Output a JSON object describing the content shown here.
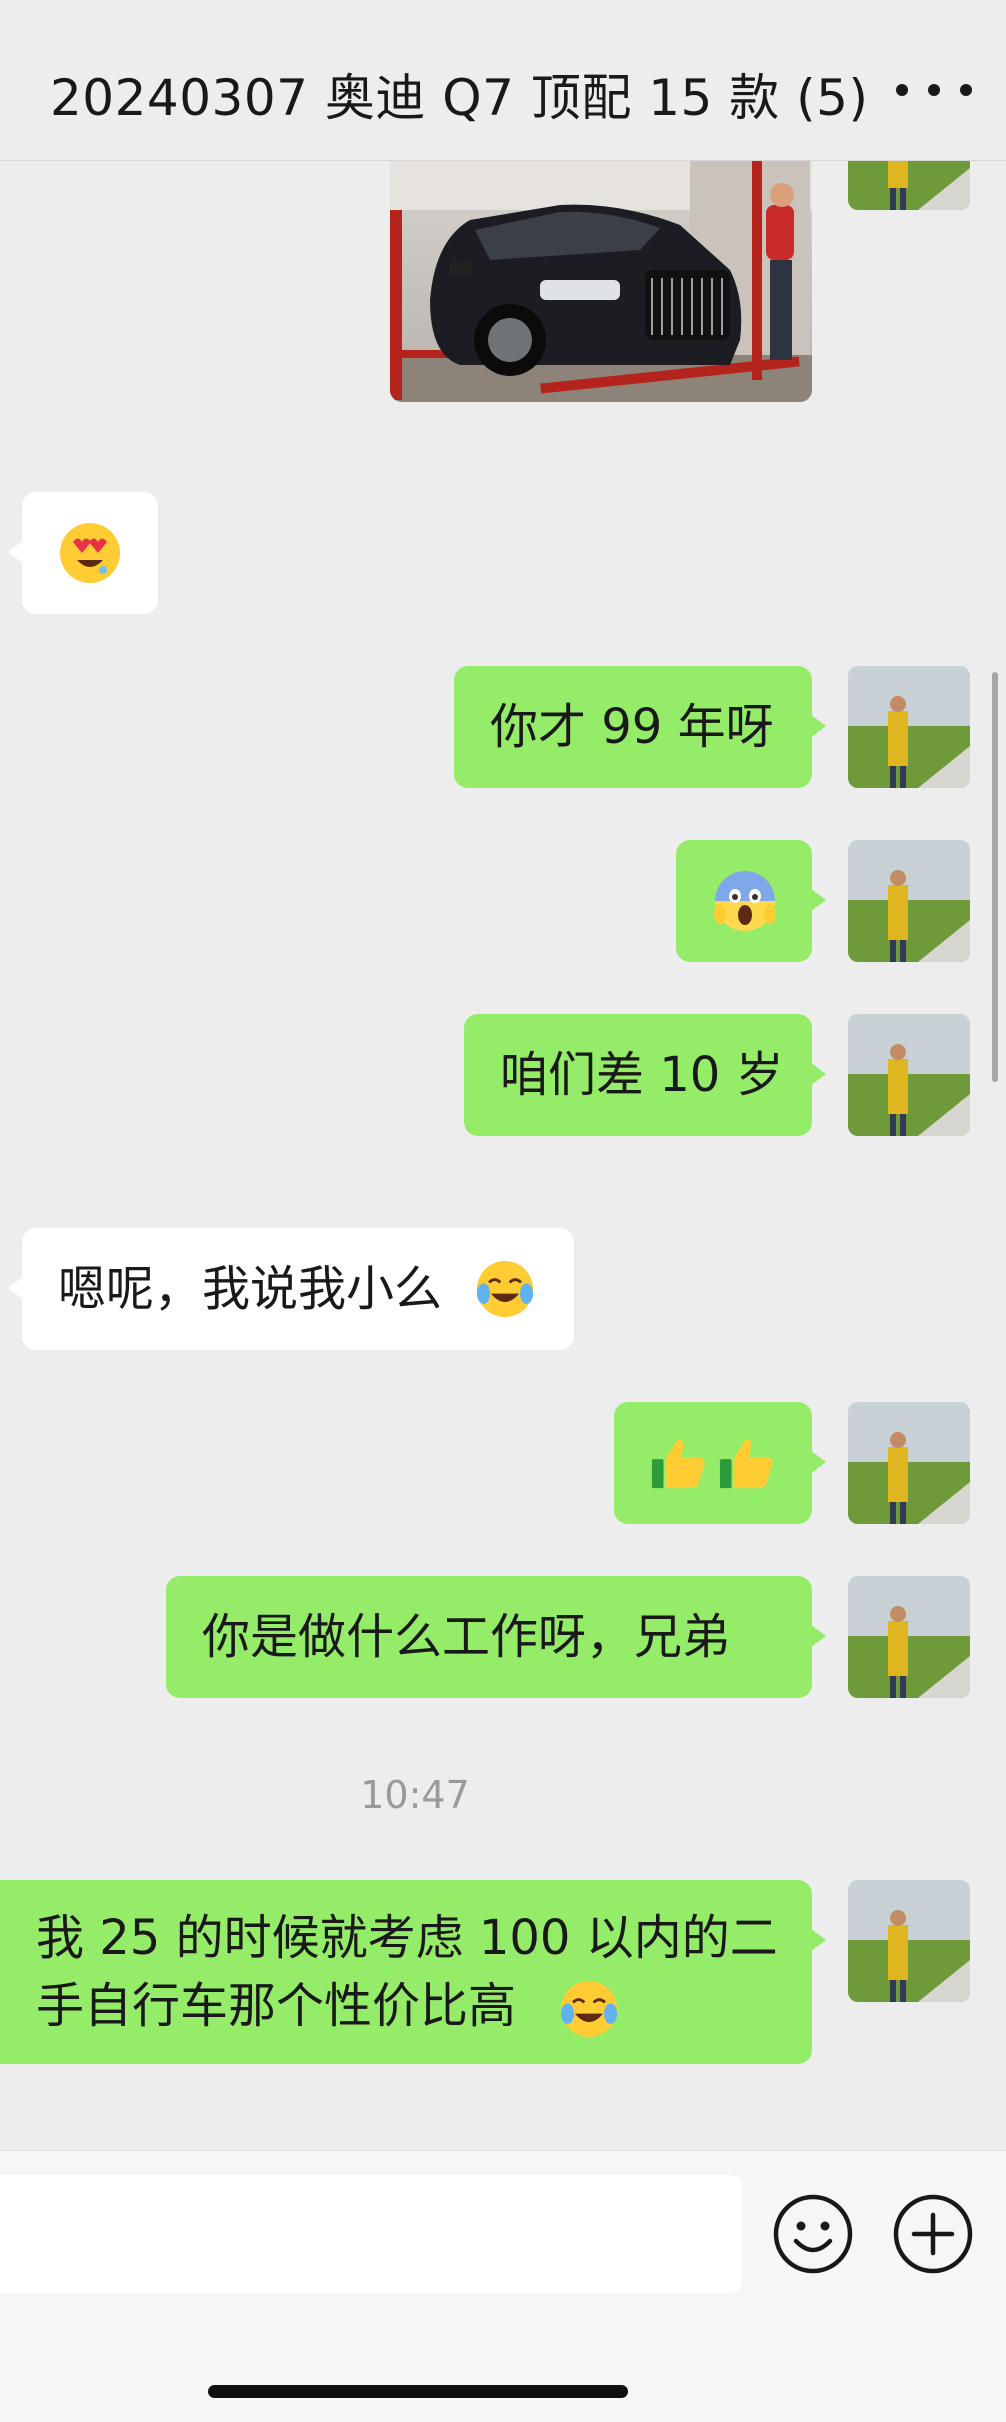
{
  "header": {
    "title": "20240307 奥迪 Q7 顶配 15 款 (5)",
    "more_icon": "more-dots-icon"
  },
  "messages": [
    {
      "side": "right",
      "type": "image",
      "content": "photo of black Audi Q7 SUV on a lift in a garage"
    },
    {
      "side": "left",
      "type": "emoji",
      "content": "😍"
    },
    {
      "side": "right",
      "type": "text",
      "content": "你才 99 年呀"
    },
    {
      "side": "right",
      "type": "emoji",
      "content": "😱"
    },
    {
      "side": "right",
      "type": "text",
      "content": "咱们差 10 岁"
    },
    {
      "side": "left",
      "type": "text",
      "content": "嗯呢，我说我小么"
    },
    {
      "side": "right",
      "type": "emoji",
      "content": "👍👍"
    },
    {
      "side": "right",
      "type": "text",
      "content": "你是做什么工作呀，兄弟"
    },
    {
      "side": "right",
      "type": "text",
      "content": "我 25 的时候就考虑 100 以内的二手自行车那个性价比高",
      "line1": "我 25 的时候就考虑 100 以内的二",
      "line2": "手自行车那个性价比高"
    }
  ],
  "timestamp": "10:47",
  "input": {
    "value": "",
    "emoji_button_icon": "smiley-face-icon",
    "plus_button_icon": "plus-circle-icon"
  },
  "colors": {
    "background": "#ededed",
    "bubble_right": "#95ec69",
    "bubble_left": "#ffffff",
    "text": "#191919",
    "timestamp": "#9a9a9a"
  }
}
